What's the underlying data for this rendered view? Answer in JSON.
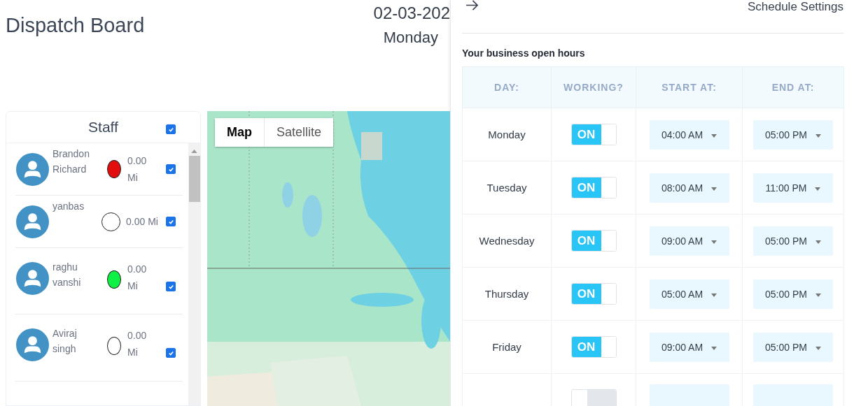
{
  "page": {
    "title": "Dispatch Board",
    "date": "02-03-202",
    "weekday": "Monday"
  },
  "staff": {
    "title": "Staff",
    "all_checked": true,
    "members": [
      {
        "name": "Brandon Richard",
        "distance": "0.00 Mi",
        "color": "#e20e0e",
        "checked": true
      },
      {
        "name": "yanbas",
        "distance": "0.00 Mi",
        "color": "#ffffff",
        "checked": true
      },
      {
        "name": "raghu vanshi",
        "distance": "0.00 Mi",
        "color": "#0ef046",
        "checked": true
      },
      {
        "name": "Aviraj singh",
        "distance": "0.00 Mi",
        "color": "#ffffff",
        "checked": true
      }
    ]
  },
  "map": {
    "map_types": [
      {
        "label": "Map",
        "selected": true
      },
      {
        "label": "Satellite",
        "selected": false
      }
    ]
  },
  "schedule_settings": {
    "title": "Schedule Settings",
    "section_title": "Your business open hours",
    "columns": [
      "DAY:",
      "WORKING?",
      "START AT:",
      "END AT:"
    ],
    "rows": [
      {
        "day": "Monday",
        "working": true,
        "toggle_label": "ON",
        "start": "04:00 AM",
        "end": "05:00 PM"
      },
      {
        "day": "Tuesday",
        "working": true,
        "toggle_label": "ON",
        "start": "08:00 AM",
        "end": "11:00 PM"
      },
      {
        "day": "Wednesday",
        "working": true,
        "toggle_label": "ON",
        "start": "09:00 AM",
        "end": "05:00 PM"
      },
      {
        "day": "Thursday",
        "working": true,
        "toggle_label": "ON",
        "start": "05:00 AM",
        "end": "05:00 PM"
      },
      {
        "day": "Friday",
        "working": true,
        "toggle_label": "ON",
        "start": "09:00 AM",
        "end": "05:00 PM"
      },
      {
        "working": false
      }
    ]
  }
}
